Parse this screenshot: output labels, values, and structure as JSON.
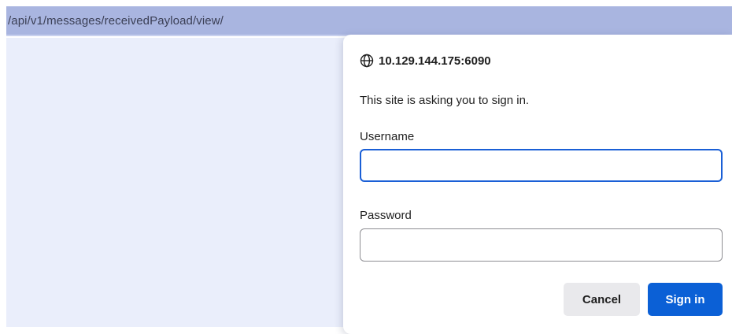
{
  "browser": {
    "url_path": "/api/v1/messages/receivedPayload/view/"
  },
  "auth_dialog": {
    "site_icon": "globe-icon",
    "site_host": "10.129.144.175:6090",
    "message": "This site is asking you to sign in.",
    "username_label": "Username",
    "username_value": "",
    "password_label": "Password",
    "password_value": "",
    "cancel_label": "Cancel",
    "signin_label": "Sign in"
  },
  "colors": {
    "url_bar": "#a9b5e0",
    "page_background": "#eaeefb",
    "focus_ring": "#1a5fd6",
    "primary_button": "#0b60d6",
    "secondary_button": "#e9e9ec"
  }
}
